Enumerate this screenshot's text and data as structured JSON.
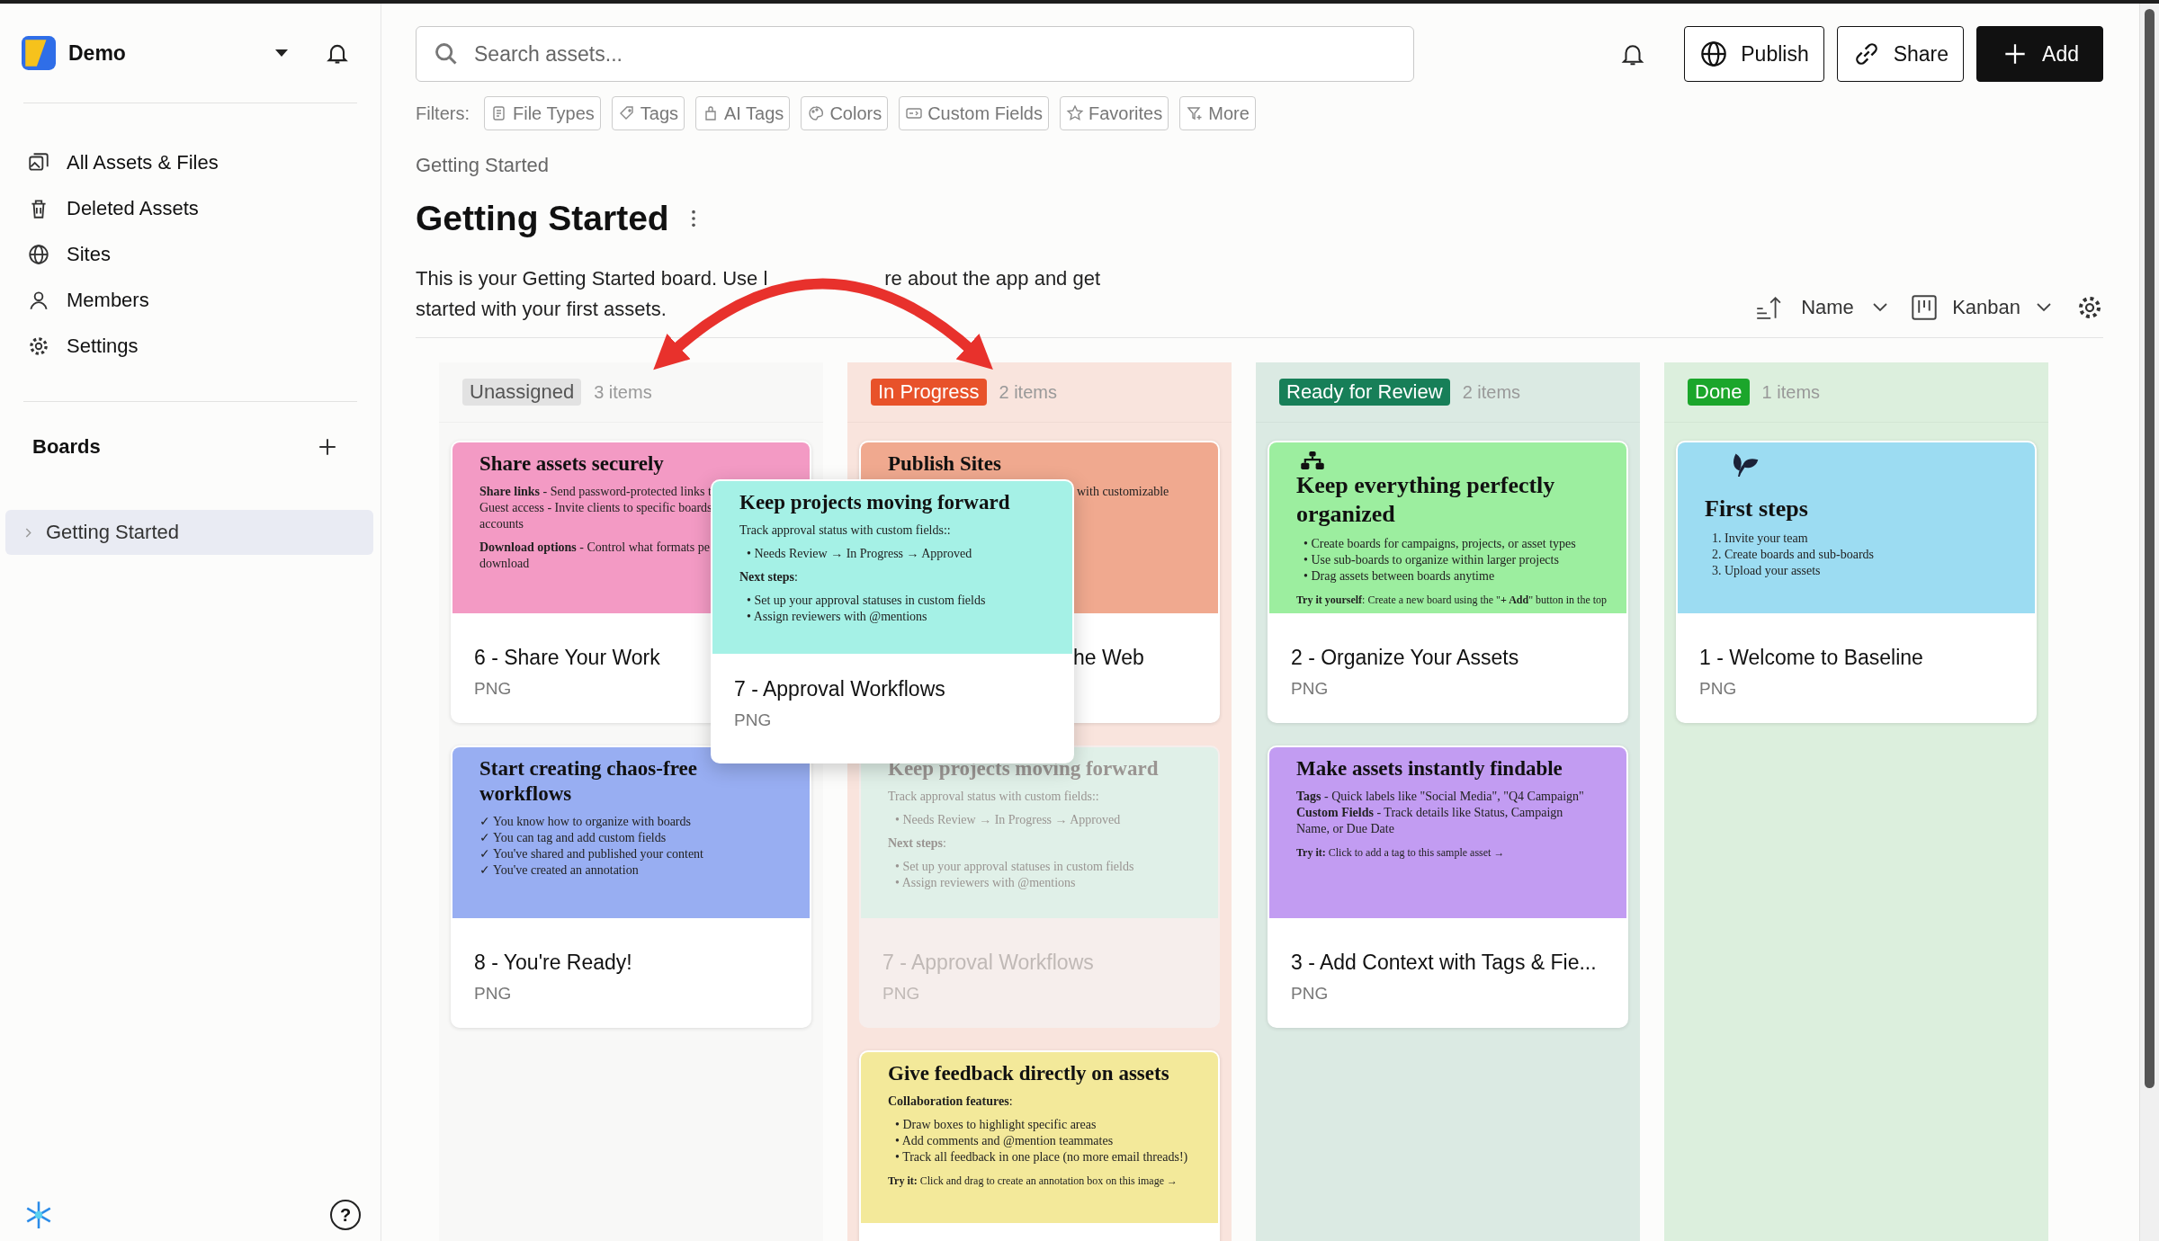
{
  "sidebar": {
    "workspace": "Demo",
    "nav": [
      {
        "label": "All Assets & Files",
        "selected": false
      },
      {
        "label": "Deleted Assets",
        "selected": false
      },
      {
        "label": "Sites",
        "selected": false
      },
      {
        "label": "Members",
        "selected": false
      },
      {
        "label": "Settings",
        "selected": false
      }
    ],
    "boards_heading": "Boards",
    "boards": [
      {
        "label": "Getting Started",
        "selected": true,
        "expanded": false
      }
    ],
    "help": "?"
  },
  "search": {
    "placeholder": "Search assets..."
  },
  "actions": [
    {
      "label": "Publish",
      "kind": "outline"
    },
    {
      "label": "Share",
      "kind": "outline"
    },
    {
      "label": "Add",
      "kind": "primary"
    }
  ],
  "filters": {
    "label": "Filters:",
    "items": [
      "File Types",
      "Tags",
      "AI Tags",
      "Colors",
      "Custom Fields",
      "Favorites",
      "More"
    ]
  },
  "breadcrumb": "Getting Started",
  "title": "Getting Started",
  "description": {
    "before": "This is your Getting Started board. Use l",
    "after": "re about the app and get",
    "line2": "started with your first assets."
  },
  "view": {
    "sort": "Name",
    "layout": "Kanban"
  },
  "columns": [
    {
      "label": "Unassigned",
      "count": "3 items",
      "color": "#e2e2e2",
      "cards": [
        {
          "name": "6 - Share Your Work",
          "type": "PNG",
          "faded": false,
          "covered": false,
          "thumbnail": {
            "color": "#f39ac4",
            "heading": "Share assets securely",
            "blocks": [
              {
                "kind": "lines",
                "lines": [
                  "**Share links** - Send password-protected links t",
                  "Guest access - Invite clients to specific boards",
                  "accounts"
                ]
              },
              {
                "kind": "lines",
                "lines": [
                  "**Download options** - Control what formats pe",
                  "download"
                ]
              }
            ]
          }
        },
        {
          "name": "8 - You're Ready!",
          "type": "PNG",
          "faded": false,
          "covered": false,
          "thumbnail": {
            "color": "#98aef2",
            "heading": "Start creating chaos-free workflows",
            "blocks": [
              {
                "kind": "lines",
                "lines": [
                  "✓ You know how to organize with boards",
                  "✓ You can tag and add custom fields",
                  "✓ You've shared and published your content",
                  "✓ You've created an annotation"
                ]
              }
            ]
          }
        }
      ]
    },
    {
      "label": "In Progress",
      "count": "2 items",
      "color": "#e8522a",
      "cards": [
        {
          "name": "he Web",
          "faded": false,
          "covered": true,
          "thumbnail": {
            "color": "#f0a98f",
            "heading": "Publish Sites",
            "blocks": [
              {
                "kind": "lines",
                "lines": [
                  "with customizable"
                ]
              }
            ]
          }
        },
        {
          "name": "7 - Approval Workflows",
          "type": "PNG",
          "faded": true,
          "covered": false,
          "thumbnail": {
            "color": "#e0f0e8",
            "heading": "Keep projects moving forward",
            "blocks": [
              {
                "kind": "lines",
                "lines": [
                  "Track approval status with custom fields::"
                ]
              },
              {
                "kind": "bullets",
                "items": [
                  "• Needs Review → In Progress → Approved"
                ]
              },
              {
                "kind": "lines",
                "lines": [
                  "**Next steps**:"
                ]
              },
              {
                "kind": "bullets",
                "items": [
                  "• Set up your approval statuses in custom fields",
                  "• Assign reviewers with @mentions"
                ]
              }
            ]
          }
        },
        {
          "faded": false,
          "covered": false,
          "thumbnail": {
            "color": "#f3e99a",
            "heading": "Give feedback directly on assets",
            "blocks": [
              {
                "kind": "lines",
                "lines": [
                  "**Collaboration features**:"
                ]
              },
              {
                "kind": "bullets",
                "items": [
                  "• Draw boxes to highlight specific areas",
                  "• Add comments and @mention teammates",
                  "• Track all feedback in one place (no more email threads!)"
                ]
              },
              {
                "kind": "note",
                "text": "**Try it:** Click and drag to create an annotation box on this image →"
              }
            ]
          }
        }
      ]
    },
    {
      "label": "Ready for Review",
      "count": "2 items",
      "color": "#177f58",
      "cards": [
        {
          "name": "2 - Organize Your Assets",
          "type": "PNG",
          "faded": false,
          "covered": false,
          "thumbnail": {
            "color": "#9cee9f",
            "heading": "Keep everything perfectly organized",
            "blocks": [
              {
                "kind": "bullets",
                "items": [
                  "• Create boards for campaigns, projects, or asset types",
                  "• Use sub-boards to organize within larger projects",
                  "• Drag assets between boards anytime"
                ]
              },
              {
                "kind": "note",
                "text": "**Try it yourself**: Create a new board using the \"**+ Add**\" button in the top"
              }
            ]
          }
        },
        {
          "name": "3 - Add Context with Tags & Fie...",
          "type": "PNG",
          "faded": false,
          "covered": false,
          "thumbnail": {
            "color": "#c29cf2",
            "heading": "Make assets instantly findable",
            "blocks": [
              {
                "kind": "lines",
                "lines": [
                  "**Tags** - Quick labels like \"Social Media\", \"Q4 Campaign\"",
                  "**Custom Fields** - Track details like Status, Campaign",
                  "Name, or Due Date"
                ]
              },
              {
                "kind": "note",
                "text": "**Try it:** Click to add a tag to this sample asset →"
              }
            ]
          }
        }
      ]
    },
    {
      "label": "Done",
      "count": "1 items",
      "color": "#1ba62b",
      "cards": [
        {
          "name": "1 - Welcome to Baseline",
          "type": "PNG",
          "faded": false,
          "covered": false,
          "thumbnail": {
            "color": "#9cdcf2",
            "heading": "First steps",
            "blocks": [
              {
                "kind": "numbered",
                "items": [
                  "1. Invite your team",
                  "2. Create boards and sub-boards",
                  "3. Upload your assets"
                ]
              }
            ]
          }
        }
      ]
    }
  ],
  "dragging": {
    "name": "7 - Approval Workflows",
    "type": "PNG",
    "thumbnail": {
      "color": "#a5f1e6",
      "heading": "Keep projects moving forward",
      "blocks": [
        {
          "kind": "lines",
          "lines": [
            "Track approval status with custom fields::"
          ]
        },
        {
          "kind": "bullets",
          "items": [
            "• Needs Review → In Progress → Approved"
          ]
        },
        {
          "kind": "lines",
          "lines": [
            "**Next steps**:"
          ]
        },
        {
          "kind": "bullets",
          "items": [
            "• Set up your approval statuses in custom fields",
            "• Assign reviewers with @mentions"
          ]
        }
      ]
    }
  }
}
